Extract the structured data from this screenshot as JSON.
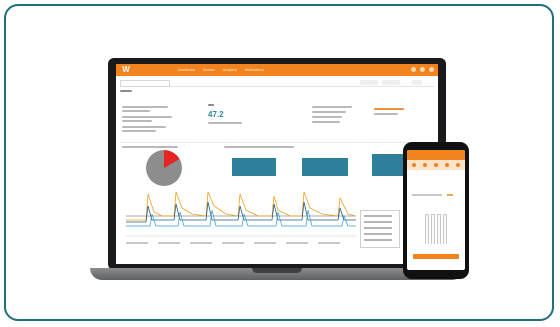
{
  "laptop": {
    "app": {
      "logo_text": "W",
      "brand_color": "#f2841f",
      "nav_items": [
        "Dashboard",
        "Monitor",
        "Analytics",
        "Notifications"
      ],
      "kpi_value": "47.2",
      "accent_color": "#2b8a97"
    },
    "pie_chart": {
      "slices": [
        {
          "color": "#e52521",
          "fraction": 0.17
        },
        {
          "color": "#8d8d8d",
          "fraction": 0.83
        }
      ]
    },
    "bar_chart": {
      "bar_color": "#2d7f9b"
    },
    "line_chart": {
      "series_colors": [
        "#f0a020",
        "#1f5f8c",
        "#3a9ad0",
        "#555555"
      ]
    }
  },
  "phone": {
    "header_color": "#f2841f",
    "header_title": "",
    "tab_count": 5
  }
}
